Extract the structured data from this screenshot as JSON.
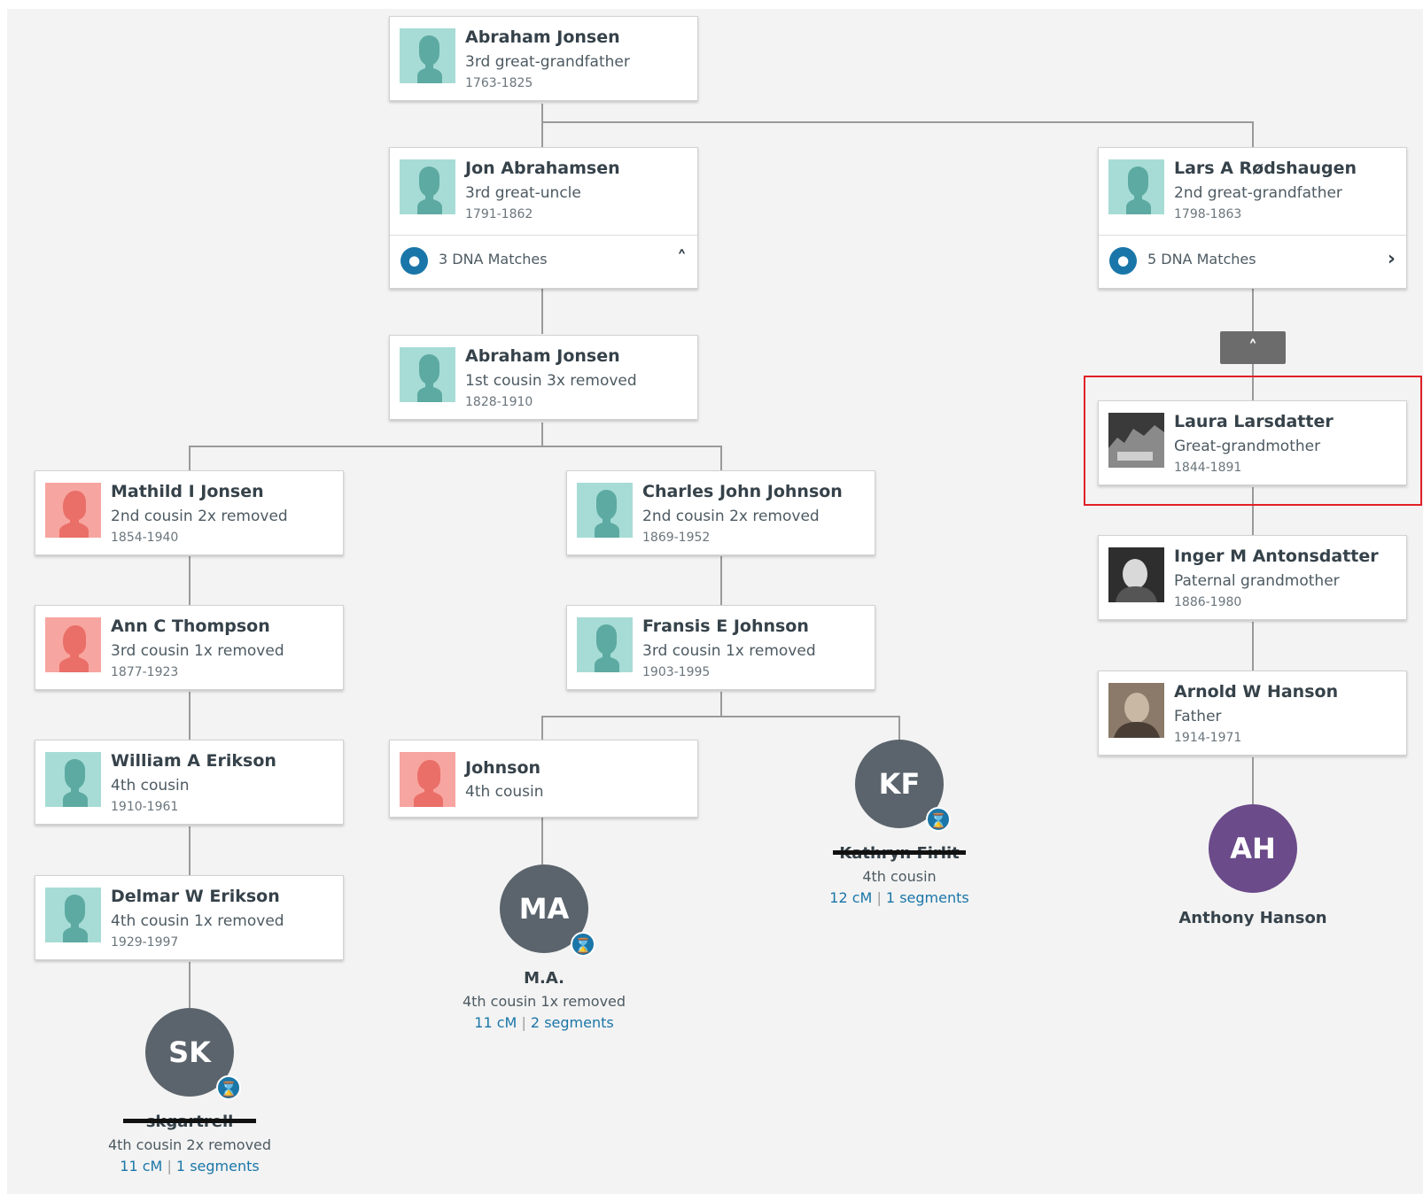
{
  "tree": {
    "people": [
      {
        "id": "abraham-jonsen-1",
        "name": "Abraham Jonsen",
        "relationship": "3rd great-grandfather",
        "years": "1763-1825"
      },
      {
        "id": "jon-abrahamsen",
        "name": "Jon Abrahamsen",
        "relationship": "3rd great-uncle",
        "years": "1791-1862",
        "dna_matches": "3 DNA Matches"
      },
      {
        "id": "lars-rodshaugen",
        "name": "Lars A Rødshaugen",
        "relationship": "2nd great-grandfather",
        "years": "1798-1863",
        "dna_matches": "5 DNA Matches"
      },
      {
        "id": "abraham-jonsen-2",
        "name": "Abraham Jonsen",
        "relationship": "1st cousin 3x removed",
        "years": "1828-1910"
      },
      {
        "id": "laura-larsdatter",
        "name": "Laura Larsdatter",
        "relationship": "Great-grandmother",
        "years": "1844-1891"
      },
      {
        "id": "mathild-jonsen",
        "name": "Mathild I Jonsen",
        "relationship": "2nd cousin 2x removed",
        "years": "1854-1940"
      },
      {
        "id": "charles-johnson",
        "name": "Charles John Johnson",
        "relationship": "2nd cousin 2x removed",
        "years": "1869-1952"
      },
      {
        "id": "inger-antonsdatter",
        "name": "Inger M Antonsdatter",
        "relationship": "Paternal grandmother",
        "years": "1886-1980"
      },
      {
        "id": "ann-thompson",
        "name": "Ann C Thompson",
        "relationship": "3rd cousin 1x removed",
        "years": "1877-1923"
      },
      {
        "id": "fransis-johnson",
        "name": "Fransis E Johnson",
        "relationship": "3rd cousin 1x removed",
        "years": "1903-1995"
      },
      {
        "id": "arnold-hanson",
        "name": "Arnold W Hanson",
        "relationship": "Father",
        "years": "1914-1971"
      },
      {
        "id": "william-erikson",
        "name": "William A Erikson",
        "relationship": "4th cousin",
        "years": "1910-1961"
      },
      {
        "id": "johnson",
        "name": "Johnson",
        "relationship": "4th cousin",
        "years": ""
      },
      {
        "id": "delmar-erikson",
        "name": "Delmar W Erikson",
        "relationship": "4th cousin 1x removed",
        "years": "1929-1997"
      }
    ],
    "matches": [
      {
        "id": "kf",
        "initials": "KF",
        "name": "Kathryn Firlit",
        "relationship": "4th cousin",
        "cm": "12 cM",
        "separator": "|",
        "segments": "1 segments"
      },
      {
        "id": "ma",
        "initials": "MA",
        "name": "M.A.",
        "relationship": "4th cousin 1x removed",
        "cm": "11 cM",
        "separator": "|",
        "segments": "2 segments"
      },
      {
        "id": "sk",
        "initials": "SK",
        "name": "skgartrell",
        "relationship": "4th cousin 2x removed",
        "cm": "11 cM",
        "separator": "|",
        "segments": "1 segments"
      },
      {
        "id": "ah",
        "initials": "AH",
        "name": "Anthony Hanson"
      }
    ],
    "collapse_icon": "chevron-up-icon",
    "colors": {
      "male": "#a7dcd6",
      "female": "#f7a5a0",
      "dna_accent": "#1a76a8",
      "highlight": "#e02026",
      "match_purple": "#6b4b8a",
      "match_gray": "#5b646c"
    }
  }
}
